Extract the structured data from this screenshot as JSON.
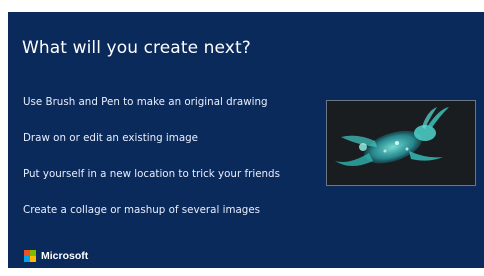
{
  "slide": {
    "title": "What will you create next?",
    "items": [
      "Use Brush and Pen to make an original drawing",
      "Draw on or edit an existing image",
      "Put yourself in a new location to trick your friends",
      "Create a collage or mashup of several images"
    ],
    "image_icon": "running-rabbit-artwork",
    "logo_text": "Microsoft"
  },
  "colors": {
    "slide_background": "#0b2a5c",
    "text": "#ffffff",
    "thumbnail_background": "#1b1f22",
    "rabbit_teal": "#34c6c0",
    "logo_red": "#f25022",
    "logo_green": "#7fba00",
    "logo_blue": "#00a4ef",
    "logo_yellow": "#ffb900"
  }
}
